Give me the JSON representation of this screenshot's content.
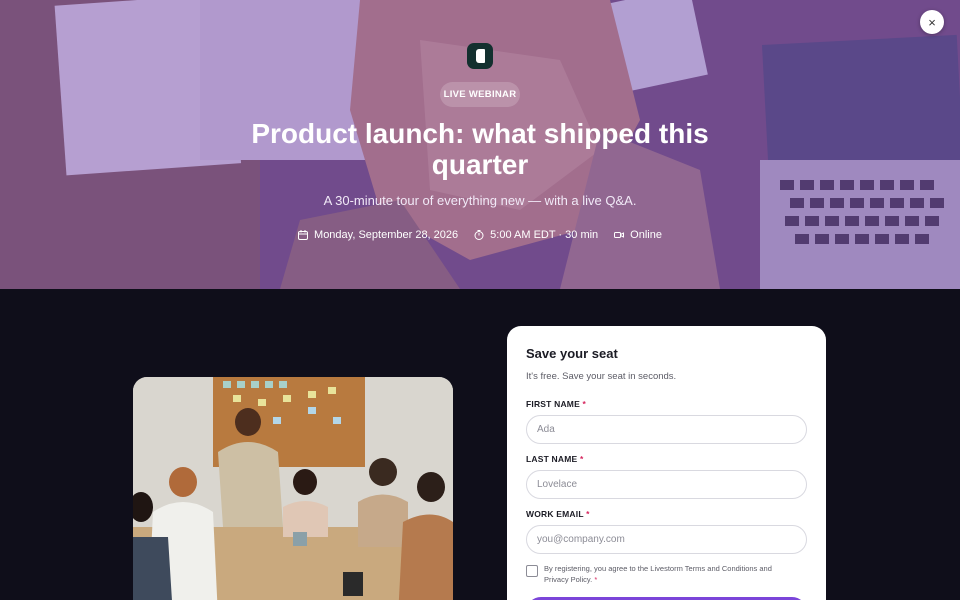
{
  "hero": {
    "badge": "LIVE WEBINAR",
    "title": "Product launch: what shipped this quarter",
    "subtitle": "A 30-minute tour of everything new — with a live Q&A.",
    "meta": {
      "date": "Monday, September 28, 2026",
      "time": "5:00 AM EDT · 30 min",
      "location": "Online"
    },
    "close_icon": "×"
  },
  "form": {
    "title": "Save your seat",
    "subtitle": "It's free. Save your seat in seconds.",
    "fields": [
      {
        "label": "FIRST NAME",
        "placeholder": "Ada"
      },
      {
        "label": "LAST NAME",
        "placeholder": "Lovelace"
      },
      {
        "label": "WORK EMAIL",
        "placeholder": "you@company.com"
      }
    ],
    "required_mark": "*",
    "consent": "By registering, you agree to the Livestorm Terms and Conditions and Privacy Policy."
  },
  "colors": {
    "accent": "#7b45d9",
    "required": "#d6265e",
    "page_bg": "#0f0e1a"
  },
  "icons": [
    "close-icon",
    "logo-icon",
    "calendar-icon",
    "clock-icon",
    "video-icon"
  ]
}
